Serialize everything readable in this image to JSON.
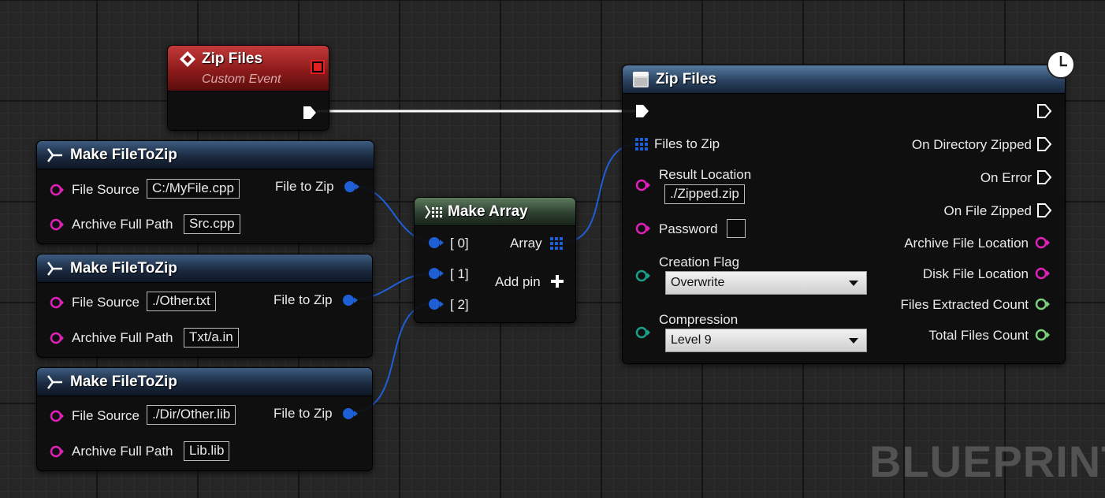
{
  "watermark": "BLUEPRINT",
  "event_node": {
    "title": "Zip Files",
    "subtitle": "Custom Event"
  },
  "make_nodes": [
    {
      "title": "Make FileToZip",
      "file_source_label": "File Source",
      "file_source_value": "C:/MyFile.cpp",
      "archive_label": "Archive Full Path",
      "archive_value": "Src.cpp",
      "output_label": "File to Zip"
    },
    {
      "title": "Make FileToZip",
      "file_source_label": "File Source",
      "file_source_value": "./Other.txt",
      "archive_label": "Archive Full Path",
      "archive_value": "Txt/a.in",
      "output_label": "File to Zip"
    },
    {
      "title": "Make FileToZip",
      "file_source_label": "File Source",
      "file_source_value": "./Dir/Other.lib",
      "archive_label": "Archive Full Path",
      "archive_value": "Lib.lib",
      "output_label": "File to Zip"
    }
  ],
  "make_array": {
    "title": "Make Array",
    "inputs": [
      "[ 0]",
      "[ 1]",
      "[ 2]"
    ],
    "output_label": "Array",
    "add_pin_label": "Add pin"
  },
  "zip_node": {
    "title": "Zip Files",
    "files_to_zip_label": "Files to Zip",
    "result_location_label": "Result Location",
    "result_location_value": "./Zipped.zip",
    "password_label": "Password",
    "creation_flag_label": "Creation Flag",
    "creation_flag_value": "Overwrite",
    "compression_label": "Compression",
    "compression_value": "Level 9",
    "outputs": {
      "on_directory_zipped": "On Directory Zipped",
      "on_error": "On Error",
      "on_file_zipped": "On File Zipped",
      "archive_file_location": "Archive File Location",
      "disk_file_location": "Disk File Location",
      "files_extracted_count": "Files Extracted Count",
      "total_files_count": "Total Files Count"
    }
  },
  "colors": {
    "struct_pin": "#1f5fd6",
    "string_pin": "#e020b8",
    "byte_pin": "#1aa08a",
    "int_pin": "#7ad07a",
    "exec": "#ffffff"
  }
}
